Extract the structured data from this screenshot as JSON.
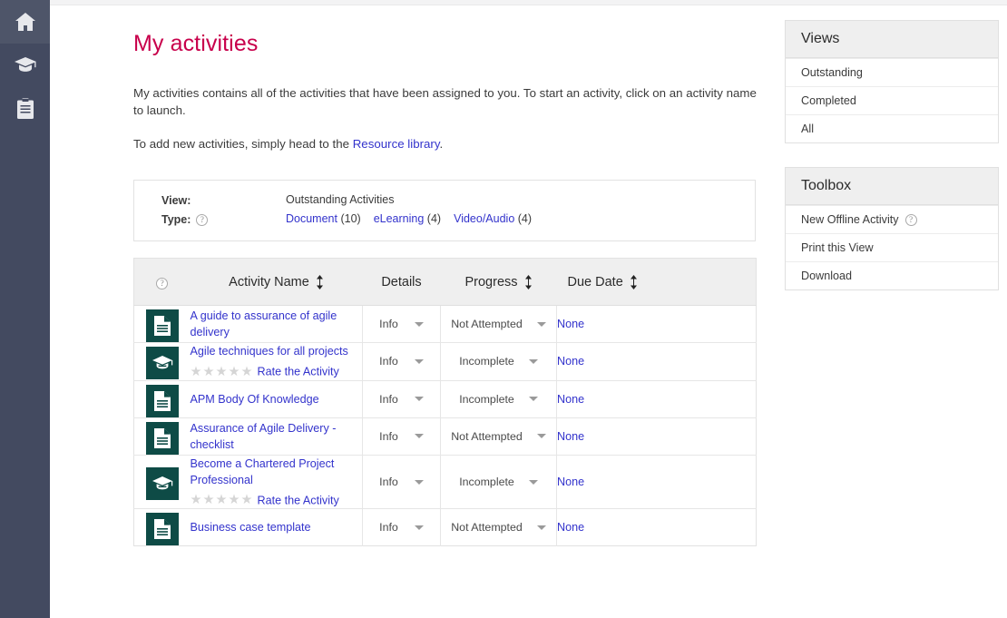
{
  "rail": {
    "items": [
      {
        "name": "home-icon",
        "label": "Home",
        "active": true
      },
      {
        "name": "learning-icon",
        "label": "Learning",
        "active": false
      },
      {
        "name": "activities-icon",
        "label": "My activities",
        "active": false
      }
    ]
  },
  "page": {
    "title": "My activities",
    "intro_1": "My activities contains all of the activities that have been assigned to you. To start an activity, click on an activity name to launch.",
    "intro_2_before": "To add new activities, simply head to the ",
    "intro_2_link": "Resource library",
    "intro_2_after": "."
  },
  "filter": {
    "view_label": "View:",
    "view_value": "Outstanding Activities",
    "type_label": "Type:",
    "type_help": "?",
    "types": [
      {
        "label": "Document",
        "count": "(10)"
      },
      {
        "label": "eLearning",
        "count": "(4)"
      },
      {
        "label": "Video/Audio",
        "count": "(4)"
      }
    ]
  },
  "table": {
    "help_header": "?",
    "headers": {
      "activity_name": "Activity Name",
      "details": "Details",
      "progress": "Progress",
      "due_date": "Due Date"
    },
    "rows": [
      {
        "icon": "document-icon",
        "name": "A guide to assurance of agile delivery",
        "rateable": false,
        "rate_label": "Rate the Activity",
        "details": "Info",
        "progress": "Not Attempted",
        "due_date": "None"
      },
      {
        "icon": "elearning-icon",
        "name": "Agile techniques for all projects",
        "rateable": true,
        "rate_label": "Rate the Activity",
        "details": "Info",
        "progress": "Incomplete",
        "due_date": "None"
      },
      {
        "icon": "document-icon",
        "name": "APM Body Of Knowledge",
        "rateable": false,
        "rate_label": "Rate the Activity",
        "details": "Info",
        "progress": "Incomplete",
        "due_date": "None"
      },
      {
        "icon": "document-icon",
        "name": "Assurance of Agile Delivery - checklist",
        "rateable": false,
        "rate_label": "Rate the Activity",
        "details": "Info",
        "progress": "Not Attempted",
        "due_date": "None"
      },
      {
        "icon": "elearning-icon",
        "name": "Become a Chartered Project Professional",
        "rateable": true,
        "rate_label": "Rate the Activity",
        "details": "Info",
        "progress": "Incomplete",
        "due_date": "None"
      },
      {
        "icon": "document-icon",
        "name": "Business case template",
        "rateable": false,
        "rate_label": "Rate the Activity",
        "details": "Info",
        "progress": "Not Attempted",
        "due_date": "None"
      }
    ]
  },
  "views_panel": {
    "title": "Views",
    "items": [
      {
        "label": "Outstanding"
      },
      {
        "label": "Completed"
      },
      {
        "label": "All"
      }
    ]
  },
  "toolbox_panel": {
    "title": "Toolbox",
    "items": [
      {
        "label": "New Offline Activity",
        "help": "?"
      },
      {
        "label": "Print this View",
        "help": ""
      },
      {
        "label": "Download",
        "help": ""
      }
    ]
  },
  "colors": {
    "accent_pink": "#c8004b",
    "link_blue": "#3333cc",
    "rail_bg": "#434a60",
    "rail_active": "#4e5569",
    "badge_green": "#0e4b46",
    "panel_head": "#efefef"
  }
}
